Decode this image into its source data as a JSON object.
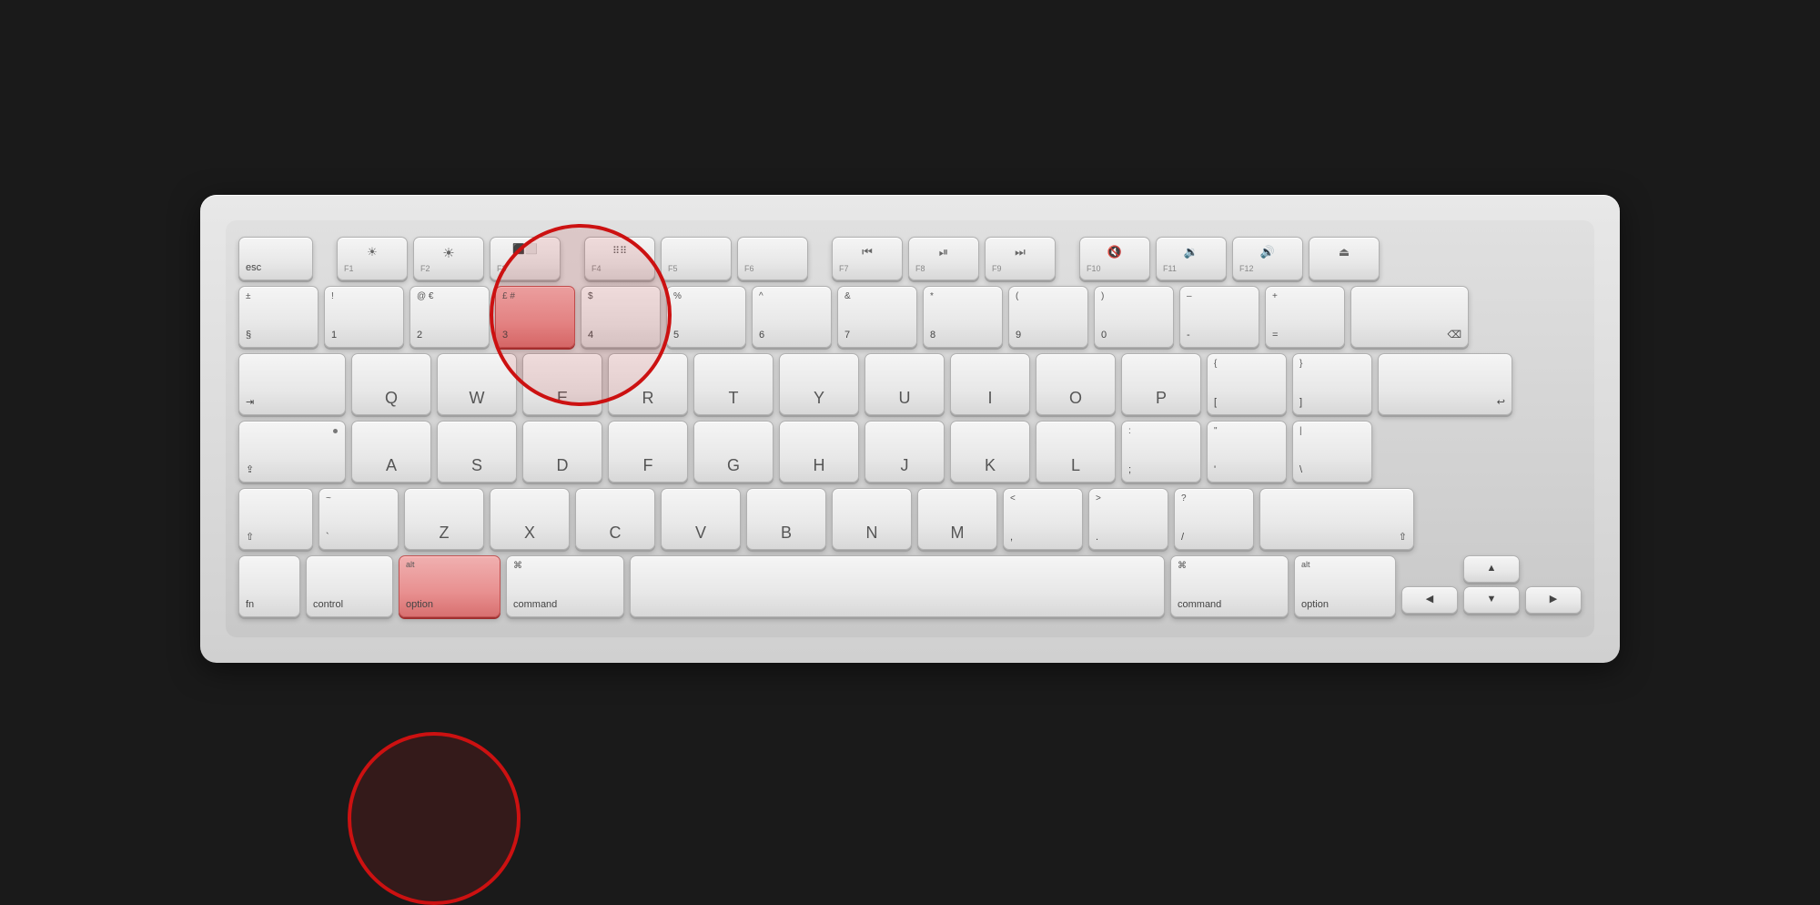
{
  "keyboard": {
    "highlighted_keys": [
      "3",
      "option_left"
    ],
    "rows": {
      "fn_row": [
        "esc",
        "F1",
        "F2",
        "F3",
        "F4",
        "F5",
        "F6",
        "F7",
        "F8",
        "F9",
        "F10",
        "F11",
        "F12",
        "eject"
      ],
      "number_row": [
        "§±",
        "1!",
        "2@€",
        "3£#",
        "4$",
        "5%",
        "6^",
        "7&",
        "8*",
        "9(",
        "0)",
        "-–",
        "+=",
        "delete"
      ],
      "qwerty_row": [
        "tab",
        "Q",
        "W",
        "E",
        "R",
        "T",
        "Y",
        "U",
        "I",
        "O",
        "P",
        "[{",
        "]}",
        "return"
      ],
      "asdf_row": [
        "caps",
        "A",
        "S",
        "D",
        "F",
        "G",
        "H",
        "J",
        "K",
        "L",
        ";:",
        "'\"",
        "\\|"
      ],
      "zxcv_row": [
        "shift",
        "~`",
        "Z",
        "X",
        "C",
        "V",
        "B",
        "N",
        "M",
        "<,",
        ">.",
        "?/",
        "shift_r"
      ],
      "bottom_row": [
        "fn",
        "control",
        "option",
        "command",
        "space",
        "command_r",
        "option_r",
        "arrows"
      ]
    }
  },
  "circles": [
    {
      "id": "circle-3",
      "label": "key 3 and surrounding area"
    },
    {
      "id": "circle-option",
      "label": "option key area"
    }
  ]
}
